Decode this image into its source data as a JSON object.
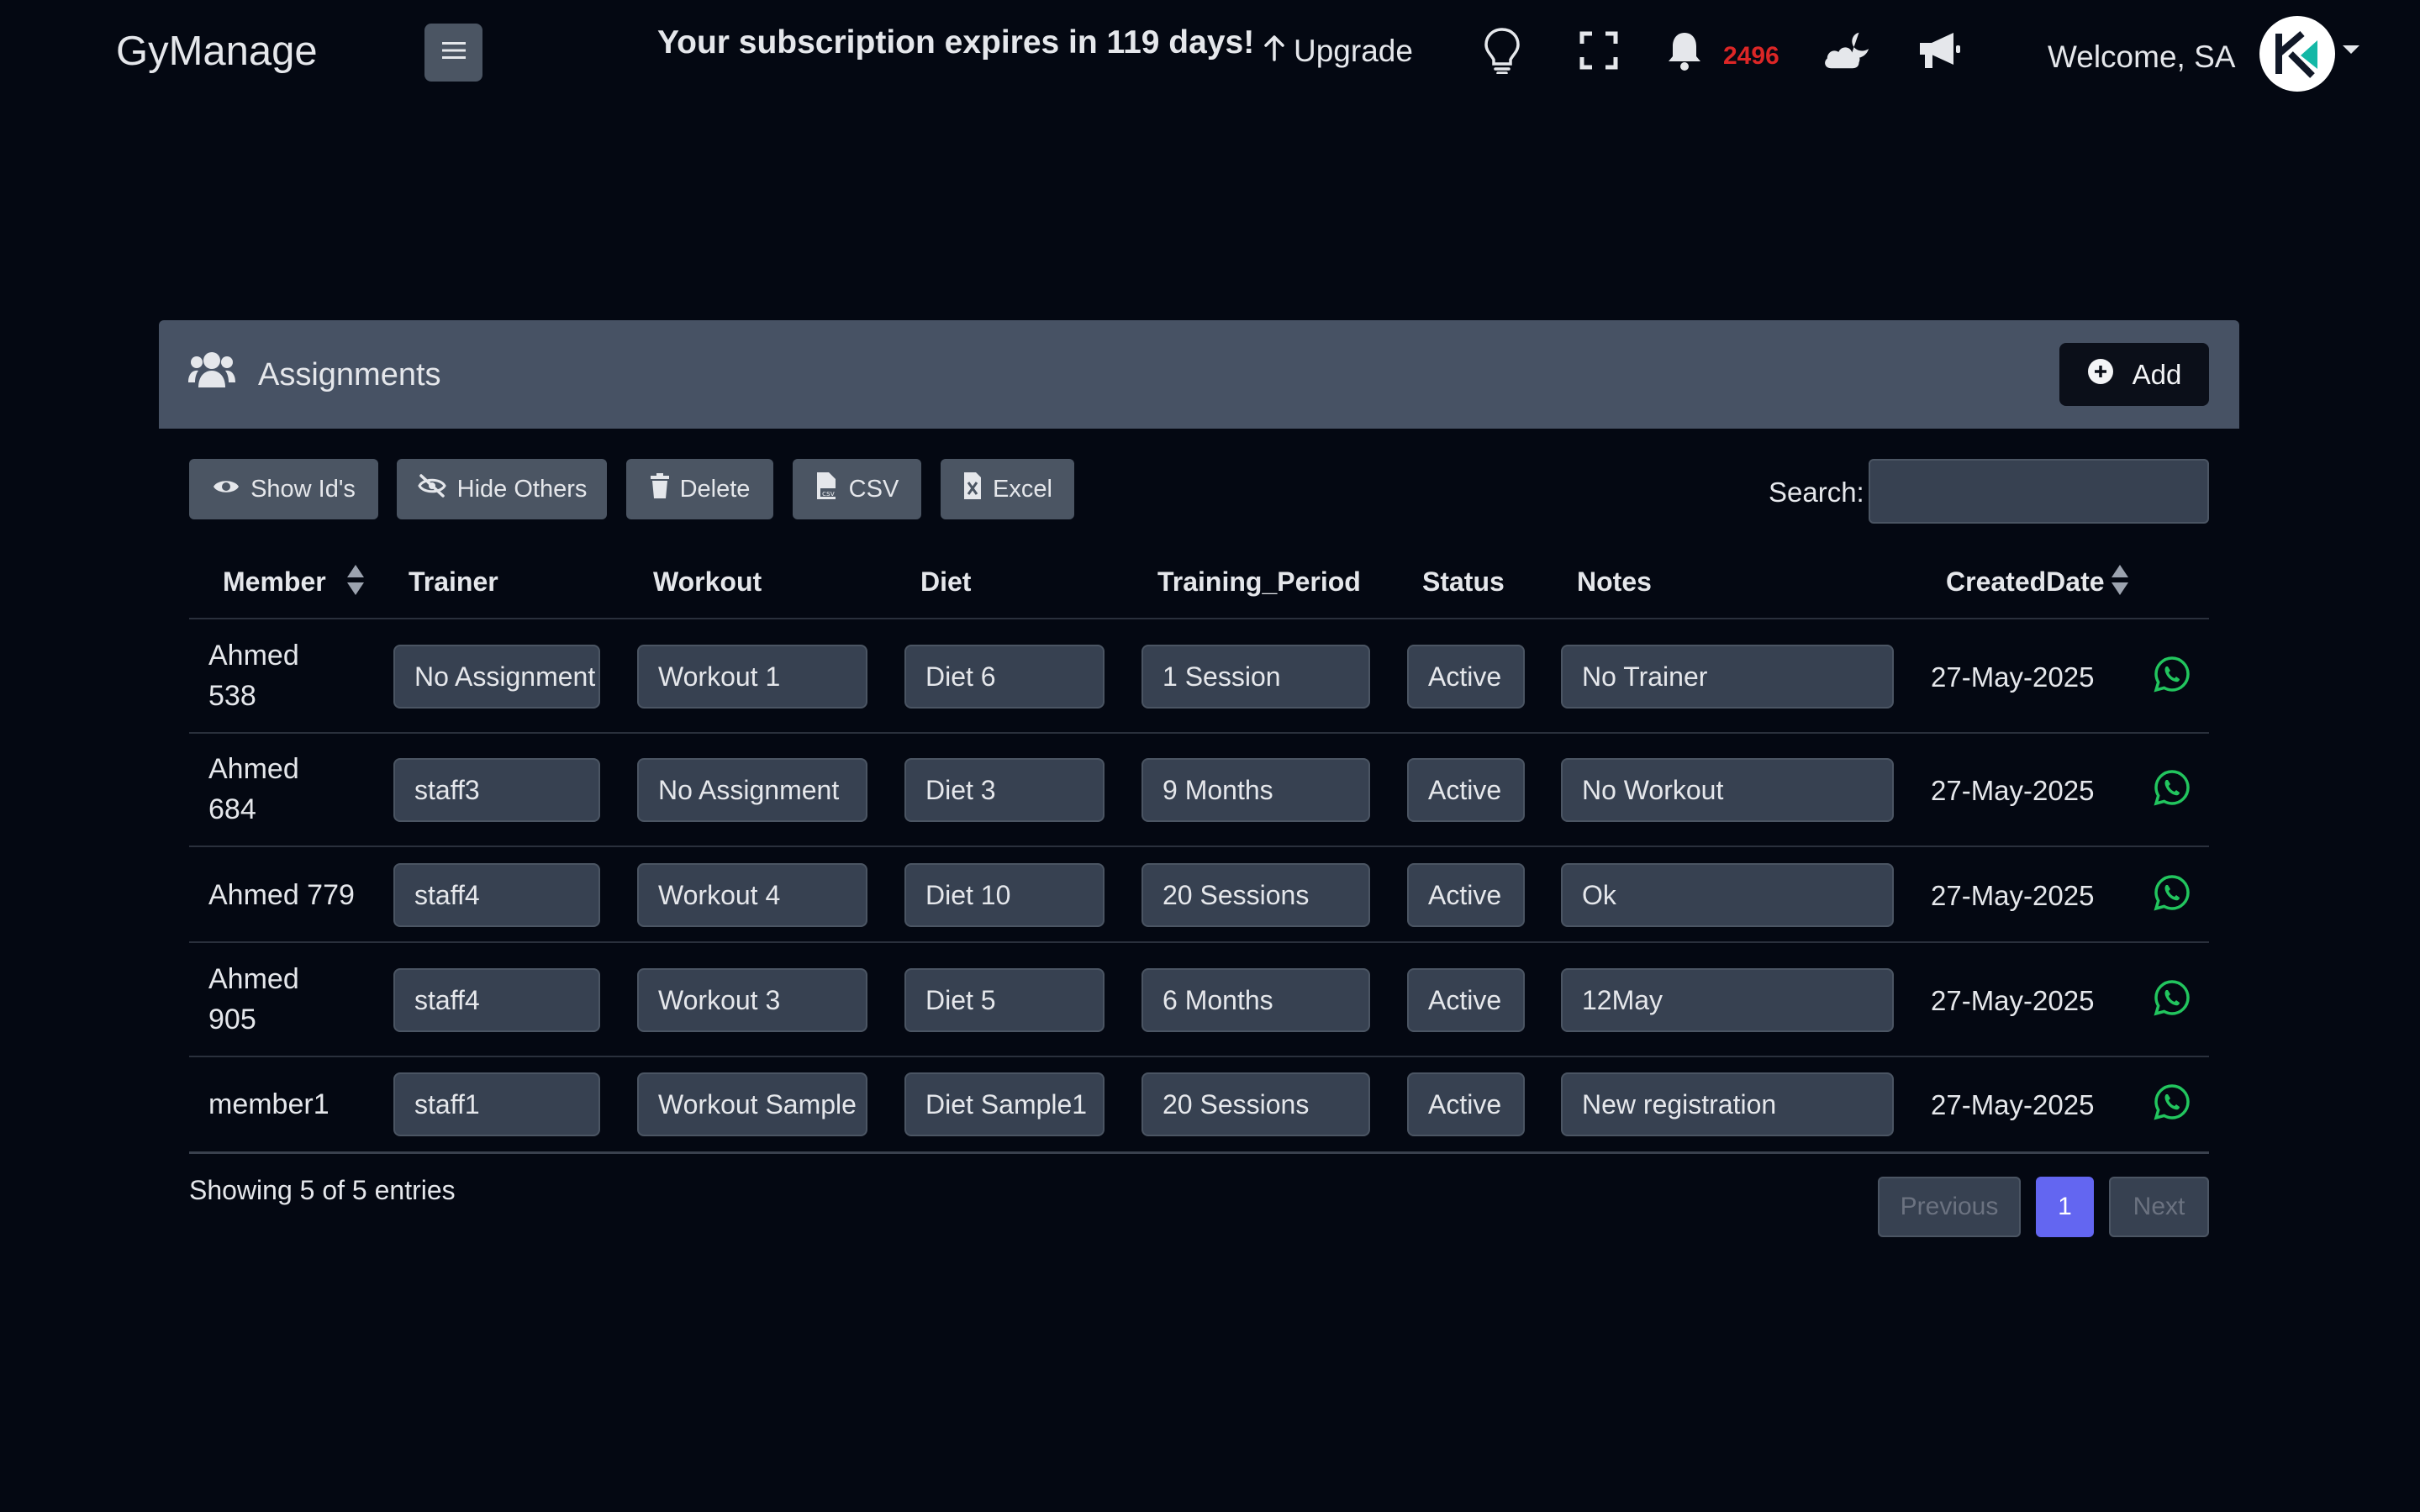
{
  "app": {
    "brand": "GyManage"
  },
  "header": {
    "subscription_message": "Your subscription expires in 119 days!",
    "upgrade_label": "Upgrade",
    "notification_count": "2496",
    "welcome_text": "Welcome, SA",
    "icons": [
      "menu-icon",
      "lightbulb-icon",
      "fullscreen-icon",
      "bell-icon",
      "cloud-moon-icon",
      "megaphone-icon",
      "chevron-down-icon"
    ]
  },
  "card": {
    "title": "Assignments",
    "add_label": "Add"
  },
  "toolbar": {
    "show_ids": "Show Id's",
    "hide_others": "Hide Others",
    "delete": "Delete",
    "csv": "CSV",
    "excel": "Excel",
    "search_label": "Search:",
    "search_value": ""
  },
  "table": {
    "columns": [
      "Member",
      "Trainer",
      "Workout",
      "Diet",
      "Training_Period",
      "Status",
      "Notes",
      "CreatedDate"
    ],
    "rows": [
      {
        "member_line1": "Ahmed",
        "member_line2": "538",
        "trainer": "No Assignment",
        "workout": "Workout 1",
        "diet": "Diet 6",
        "period": "1 Session",
        "status": "Active",
        "notes": "No Trainer",
        "date": "27-May-2025"
      },
      {
        "member_line1": "Ahmed",
        "member_line2": "684",
        "trainer": "staff3",
        "workout": "No Assignment",
        "diet": "Diet 3",
        "period": "9 Months",
        "status": "Active",
        "notes": "No Workout",
        "date": "27-May-2025"
      },
      {
        "member_line1": "Ahmed 779",
        "member_line2": "",
        "trainer": "staff4",
        "workout": "Workout 4",
        "diet": "Diet 10",
        "period": "20 Sessions",
        "status": "Active",
        "notes": "Ok",
        "date": "27-May-2025"
      },
      {
        "member_line1": "Ahmed",
        "member_line2": "905",
        "trainer": "staff4",
        "workout": "Workout 3",
        "diet": "Diet 5",
        "period": "6 Months",
        "status": "Active",
        "notes": "12May",
        "date": "27-May-2025"
      },
      {
        "member_line1": "member1",
        "member_line2": "",
        "trainer": "staff1",
        "workout": "Workout Sample",
        "diet": "Diet Sample1",
        "period": "20 Sessions",
        "status": "Active",
        "notes": "New registration",
        "date": "27-May-2025"
      }
    ]
  },
  "footer": {
    "entries_text": "Showing 5 of 5 entries",
    "previous": "Previous",
    "current_page": "1",
    "next": "Next"
  },
  "colors": {
    "background": "#040812",
    "card_header": "#475264",
    "button": "#4b5563",
    "field": "#374151",
    "notification": "#dc2626",
    "whatsapp": "#22c55e",
    "active_page": "#6366f1"
  }
}
